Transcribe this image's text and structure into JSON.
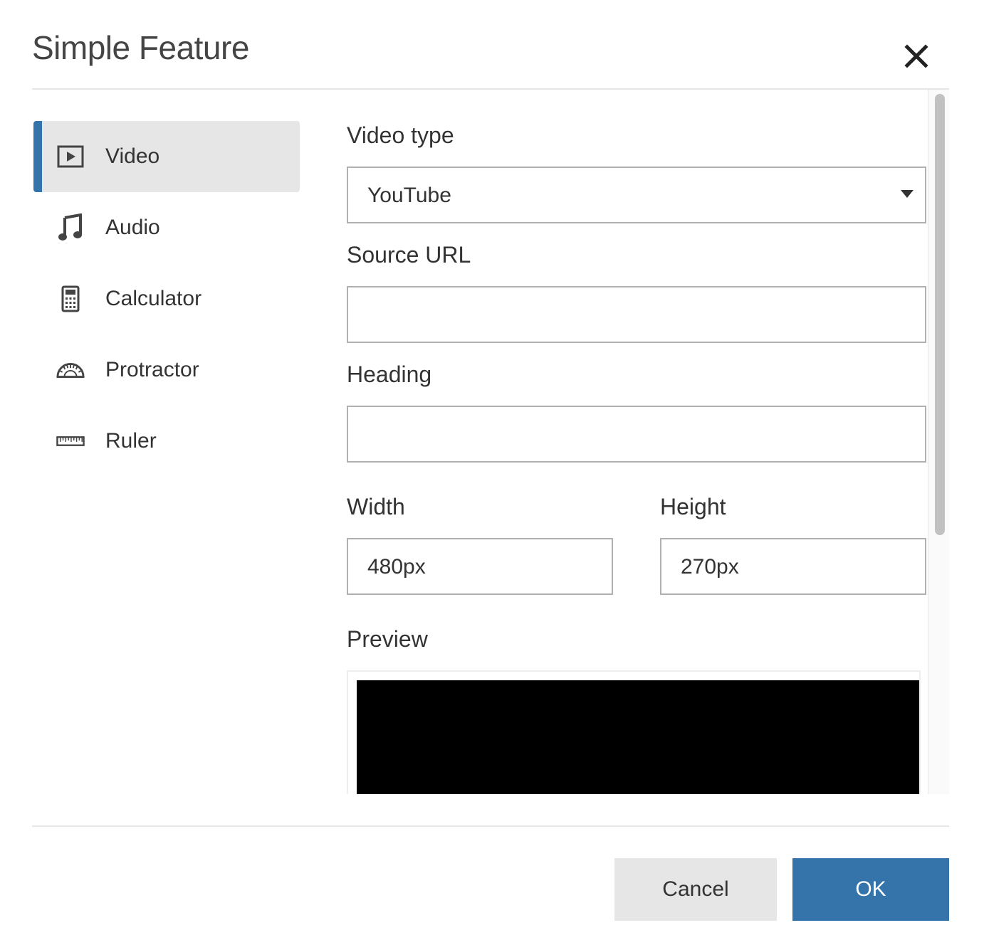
{
  "dialog": {
    "title": "Simple Feature",
    "close_icon": "close-icon"
  },
  "sidebar": {
    "items": [
      {
        "label": "Video",
        "icon": "video-play-icon",
        "active": true
      },
      {
        "label": "Audio",
        "icon": "music-note-icon",
        "active": false
      },
      {
        "label": "Calculator",
        "icon": "calculator-icon",
        "active": false
      },
      {
        "label": "Protractor",
        "icon": "protractor-icon",
        "active": false
      },
      {
        "label": "Ruler",
        "icon": "ruler-icon",
        "active": false
      }
    ]
  },
  "form": {
    "video_type": {
      "label": "Video type",
      "value": "YouTube"
    },
    "source_url": {
      "label": "Source URL",
      "value": ""
    },
    "heading": {
      "label": "Heading",
      "value": ""
    },
    "width": {
      "label": "Width",
      "value": "480px"
    },
    "height": {
      "label": "Height",
      "value": "270px"
    },
    "preview": {
      "label": "Preview"
    }
  },
  "footer": {
    "cancel_label": "Cancel",
    "ok_label": "OK"
  },
  "colors": {
    "accent": "#3574ab",
    "active_item_bg": "#e6e6e6",
    "cancel_bg": "#e6e6e6",
    "preview_bg": "#000000"
  }
}
